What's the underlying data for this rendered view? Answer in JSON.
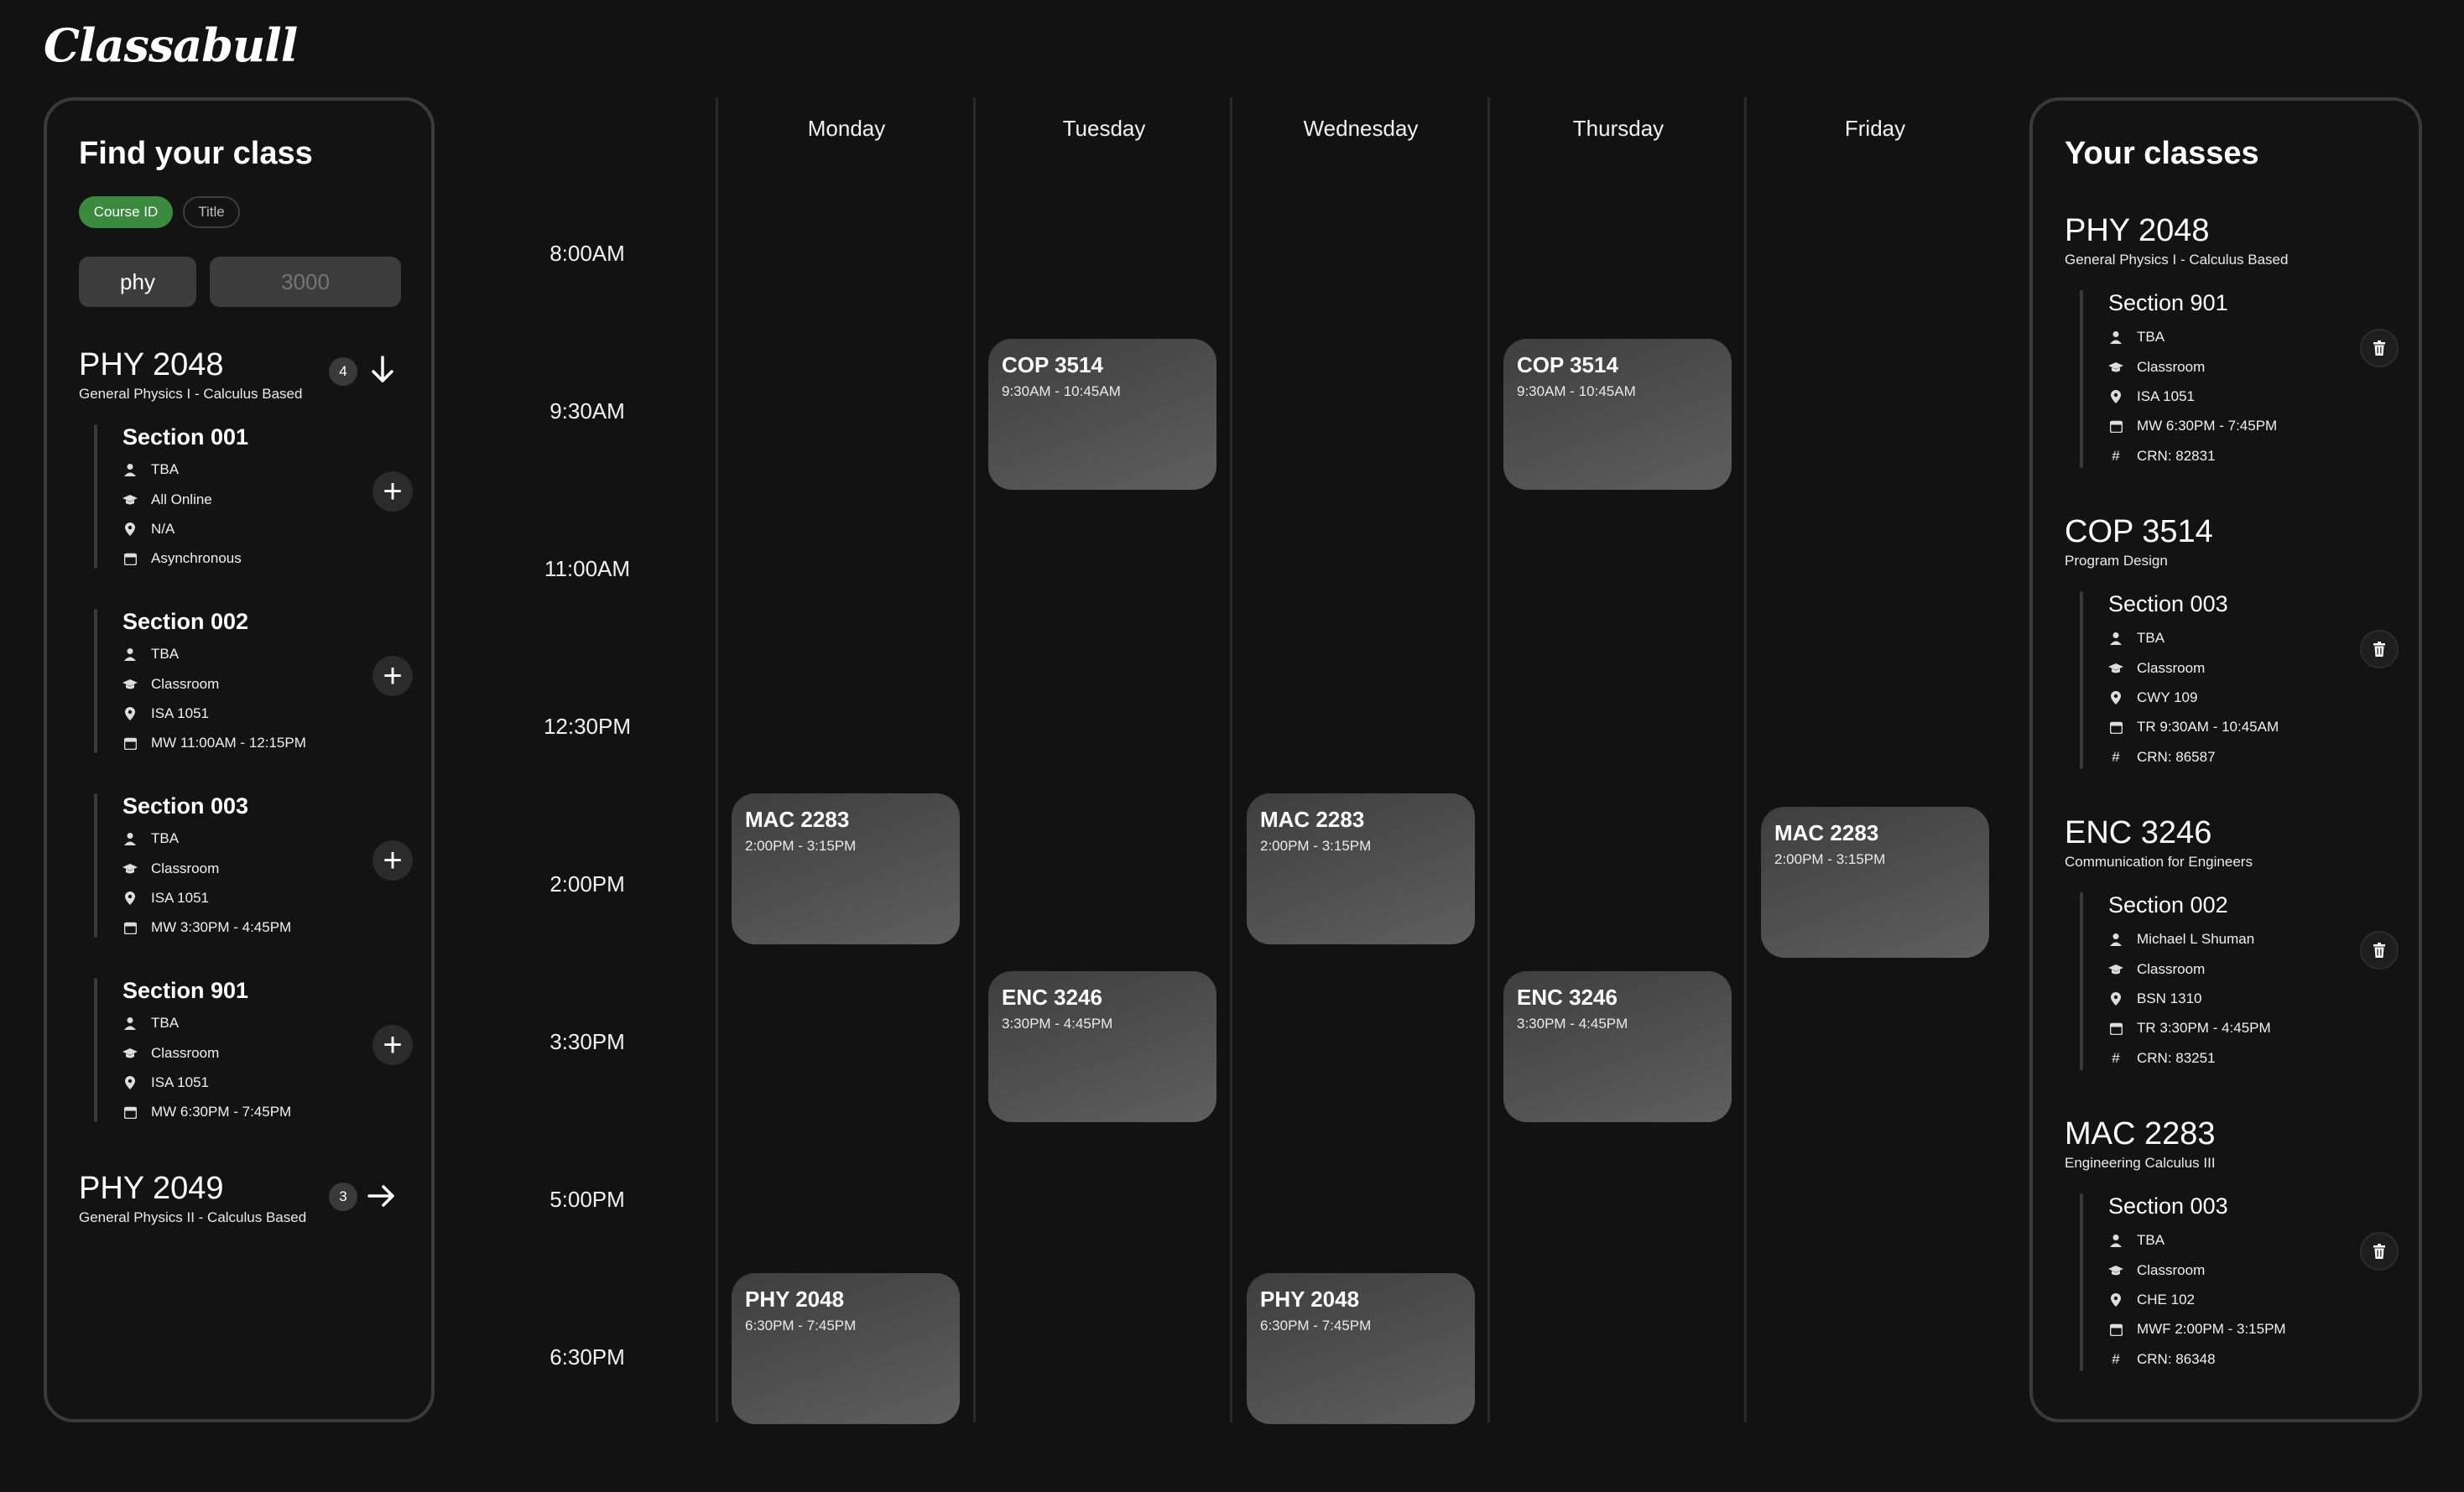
{
  "app": {
    "logo": "Classabull"
  },
  "search_panel": {
    "title": "Find your class",
    "filters": [
      "Course ID",
      "Title"
    ],
    "dept_value": "phy",
    "number_placeholder": "3000",
    "courses": [
      {
        "code": "PHY 2048",
        "name": "General Physics I - Calculus Based",
        "count": "4",
        "sections": [
          {
            "title": "Section 001",
            "instructor": "TBA",
            "mode": "All Online",
            "location": "N/A",
            "schedule": "Asynchronous"
          },
          {
            "title": "Section 002",
            "instructor": "TBA",
            "mode": "Classroom",
            "location": "ISA 1051",
            "schedule": "MW 11:00AM - 12:15PM"
          },
          {
            "title": "Section 003",
            "instructor": "TBA",
            "mode": "Classroom",
            "location": "ISA 1051",
            "schedule": "MW 3:30PM - 4:45PM"
          },
          {
            "title": "Section 901",
            "instructor": "TBA",
            "mode": "Classroom",
            "location": "ISA 1051",
            "schedule": "MW 6:30PM - 7:45PM"
          }
        ]
      },
      {
        "code": "PHY 2049",
        "name": "General Physics II - Calculus Based",
        "count": "3"
      }
    ]
  },
  "calendar": {
    "days": [
      "Monday",
      "Tuesday",
      "Wednesday",
      "Thursday",
      "Friday"
    ],
    "times": [
      "8:00AM",
      "9:30AM",
      "11:00AM",
      "12:30PM",
      "2:00PM",
      "3:30PM",
      "5:00PM",
      "6:30PM"
    ],
    "events": [
      {
        "code": "COP 3514",
        "time": "9:30AM - 10:45AM",
        "day": "Tuesday"
      },
      {
        "code": "COP 3514",
        "time": "9:30AM - 10:45AM",
        "day": "Thursday"
      },
      {
        "code": "MAC 2283",
        "time": "2:00PM - 3:15PM",
        "day": "Monday"
      },
      {
        "code": "MAC 2283",
        "time": "2:00PM - 3:15PM",
        "day": "Wednesday"
      },
      {
        "code": "MAC 2283",
        "time": "2:00PM - 3:15PM",
        "day": "Friday"
      },
      {
        "code": "ENC 3246",
        "time": "3:30PM - 4:45PM",
        "day": "Tuesday"
      },
      {
        "code": "ENC 3246",
        "time": "3:30PM - 4:45PM",
        "day": "Thursday"
      },
      {
        "code": "PHY 2048",
        "time": "6:30PM - 7:45PM",
        "day": "Monday"
      },
      {
        "code": "PHY 2048",
        "time": "6:30PM - 7:45PM",
        "day": "Wednesday"
      }
    ]
  },
  "your_classes": {
    "title": "Your classes",
    "classes": [
      {
        "code": "PHY 2048",
        "name": "General Physics I - Calculus Based",
        "section": "Section 901",
        "instructor": "TBA",
        "mode": "Classroom",
        "location": "ISA 1051",
        "schedule": "MW 6:30PM - 7:45PM",
        "crn": "CRN: 82831"
      },
      {
        "code": "COP 3514",
        "name": "Program Design",
        "section": "Section 003",
        "instructor": "TBA",
        "mode": "Classroom",
        "location": "CWY 109",
        "schedule": "TR 9:30AM - 10:45AM",
        "crn": "CRN: 86587"
      },
      {
        "code": "ENC 3246",
        "name": "Communication for Engineers",
        "section": "Section 002",
        "instructor": "Michael L Shuman",
        "mode": "Classroom",
        "location": "BSN 1310",
        "schedule": "TR 3:30PM - 4:45PM",
        "crn": "CRN: 83251"
      },
      {
        "code": "MAC 2283",
        "name": "Engineering Calculus III",
        "section": "Section 003",
        "instructor": "TBA",
        "mode": "Classroom",
        "location": "CHE 102",
        "schedule": "MWF 2:00PM - 3:15PM",
        "crn": "CRN: 86348"
      }
    ]
  },
  "icons": {
    "instructor": "person-icon",
    "mode": "graduation-cap-icon",
    "location": "map-pin-icon",
    "schedule": "calendar-icon",
    "crn": "hash-icon",
    "add": "plus-icon",
    "delete": "trash-icon",
    "expand": "arrow-down-icon",
    "collapse": "arrow-right-icon"
  },
  "colors": {
    "background": "#121212",
    "accent_green": "#3b8a3e",
    "panel_border": "#3a3a3a",
    "event_bg": "#555555"
  }
}
